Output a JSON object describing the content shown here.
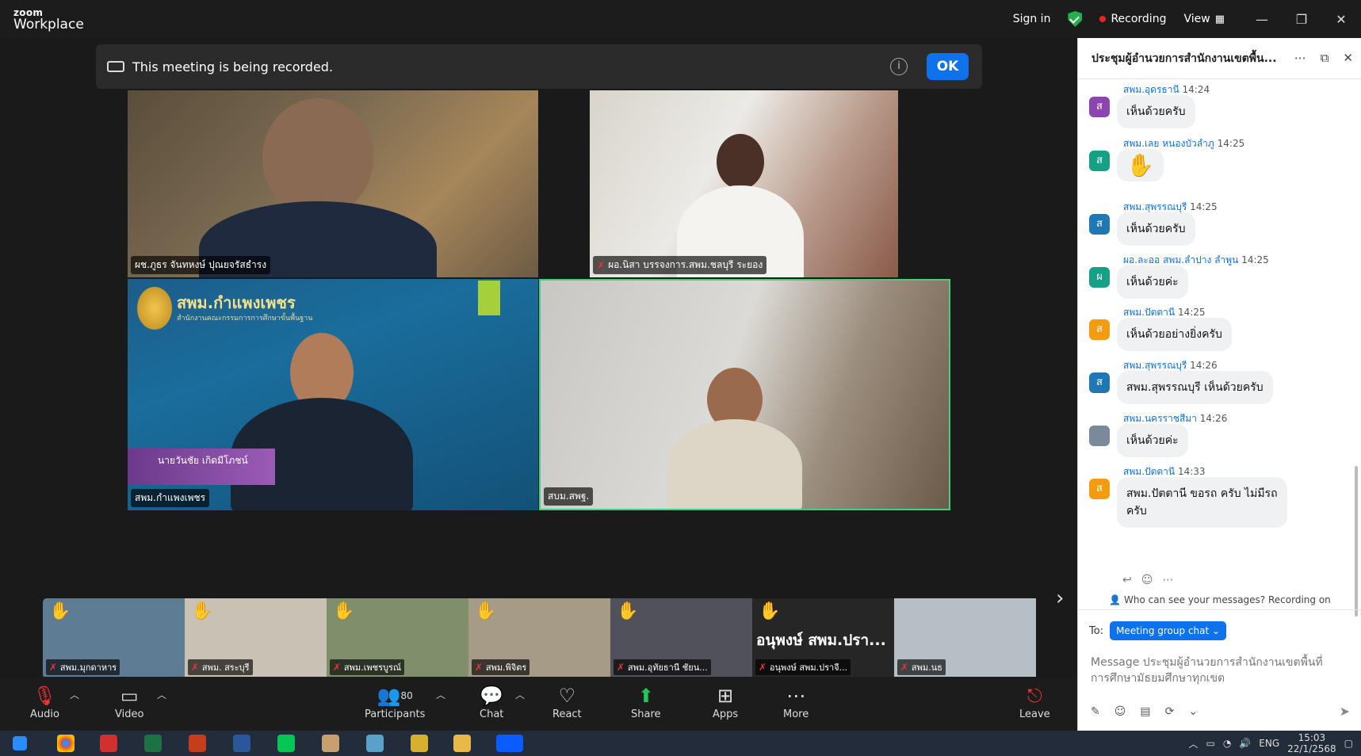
{
  "app": {
    "logo_top": "zoom",
    "logo_bottom": "Workplace"
  },
  "titlebar": {
    "sign_in": "Sign in",
    "recording": "Recording",
    "view": "View"
  },
  "banner": {
    "text": "This meeting is being recorded.",
    "ok": "OK",
    "info_icon": "i"
  },
  "tiles": [
    {
      "name": "ผช.ภูธร จันทหงษ์ ปุณยจรัสธำรง"
    },
    {
      "name": "ผอ.นิสา บรรจงการ.สพม.ชลบุรี ระยอง"
    },
    {
      "name": "สพม.กำแพงเพชร",
      "org": "สพม.กำแพงเพชร",
      "org_sub": "สำนักงานคณะกรรมการการศึกษาขั้นพื้นฐาน",
      "nametag": "นายวันชัย เกิดมีโภชน์"
    },
    {
      "name": "สบม.สพฐ."
    }
  ],
  "thumbnails": [
    {
      "name": "สพม.มุกดาหาร",
      "hand": true,
      "bg": "#5e7d94"
    },
    {
      "name": "สพม. สระบุรี",
      "hand": true,
      "bg": "#c9c1b4"
    },
    {
      "name": "สพม.เพชรบูรณ์",
      "hand": true,
      "bg": "#7f8f6c"
    },
    {
      "name": "สพม.พิจิตร",
      "hand": true,
      "bg": "#a59b87"
    },
    {
      "name": "สพม.อุทัยธานี ชัยน...",
      "hand": true,
      "bg": "#50515a"
    },
    {
      "name": "อนุพงษ์ สพม.ปราจี...",
      "hand": true,
      "bg": "#262626",
      "big": "อนุพงษ์ สพม.ปรา..."
    },
    {
      "name": "สพม.นธ",
      "hand": false,
      "bg": "#b6bfc6"
    }
  ],
  "toolbar": {
    "audio": "Audio",
    "video": "Video",
    "participants": "Participants",
    "participants_count": "80",
    "chat": "Chat",
    "react": "React",
    "share": "Share",
    "apps": "Apps",
    "more": "More",
    "leave": "Leave"
  },
  "chat": {
    "title": "ประชุมผู้อำนวยการสำนักงานเขตพื้น...",
    "messages": [
      {
        "sender": "สพม.อุดรธานี",
        "time": "14:24",
        "text": "เห็นด้วยครับ",
        "avatar": "ส",
        "color": "#8e44ad"
      },
      {
        "sender": "สพม.เลย หนองบัวลำภู",
        "time": "14:25",
        "text": "✋",
        "avatar": "ส",
        "color": "#16a085"
      },
      {
        "sender": "สพม.สุพรรณบุรี",
        "time": "14:25",
        "text": "เห็นด้วยครับ",
        "avatar": "ส",
        "color": "#1f77b4"
      },
      {
        "sender": "ผอ.ละออ สพม.ลำปาง ลำพูน",
        "time": "14:25",
        "text": "เห็นด้วยค่ะ",
        "avatar": "ผ",
        "color": "#16a085"
      },
      {
        "sender": "สพม.ปัตตานี",
        "time": "14:25",
        "text": "เห็นด้วยอย่างยิ่งครับ",
        "avatar": "ส",
        "color": "#f39c12"
      },
      {
        "sender": "สพม.สุพรรณบุรี",
        "time": "14:26",
        "text": "สพม.สุพรรณบุรี เห็นด้วยครับ",
        "avatar": "ส",
        "color": "#1f77b4"
      },
      {
        "sender": "สพม.นครราชสีมา",
        "time": "14:26",
        "text": "เห็นด้วยค่ะ",
        "avatar": "",
        "color": "#7a8a9a"
      },
      {
        "sender": "สพม.ปัตตานี",
        "time": "14:33",
        "text": "สพม.ปัตตานี ขอรถ ครับ ไม่มีรถ",
        "text2": "ครับ",
        "avatar": "ส",
        "color": "#f39c12"
      }
    ],
    "who_can_see": "Who can see your messages? Recording on",
    "to_label": "To:",
    "to_value": "Meeting group chat",
    "input_placeholder_1": "Message ประชุมผู้อำนวยการสำนักงานเขตพื้นที่",
    "input_placeholder_2": "การศึกษามัธยมศึกษาทุกเขต"
  },
  "taskbar": {
    "lang": "ENG",
    "time": "15:03",
    "date": "22/1/2568"
  }
}
